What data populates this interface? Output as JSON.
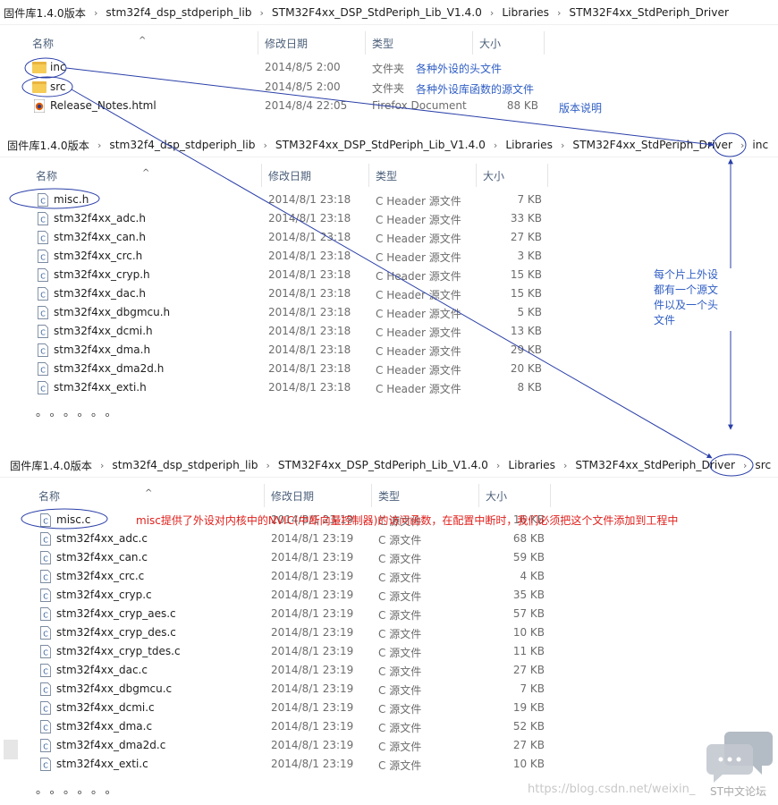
{
  "panel1": {
    "breadcrumb": [
      "固件库1.4.0版本",
      "stm32f4_dsp_stdperiph_lib",
      "STM32F4xx_DSP_StdPeriph_Lib_V1.4.0",
      "Libraries",
      "STM32F4xx_StdPeriph_Driver"
    ],
    "columns": {
      "name": "名称",
      "date": "修改日期",
      "type": "类型",
      "size": "大小"
    },
    "rows": [
      {
        "name": "inc",
        "date": "2014/8/5 2:00",
        "type": "文件夹",
        "size": "",
        "note": "各种外设的头文件"
      },
      {
        "name": "src",
        "date": "2014/8/5 2:00",
        "type": "文件夹",
        "size": "",
        "note": "各种外设库函数的源文件"
      },
      {
        "name": "Release_Notes.html",
        "date": "2014/8/4 22:05",
        "type": "Firefox Document",
        "size": "88 KB",
        "note": "版本说明"
      }
    ]
  },
  "panel2": {
    "breadcrumb": [
      "固件库1.4.0版本",
      "stm32f4_dsp_stdperiph_lib",
      "STM32F4xx_DSP_StdPeriph_Lib_V1.4.0",
      "Libraries",
      "STM32F4xx_StdPeriph_Driver",
      "inc"
    ],
    "columns": {
      "name": "名称",
      "date": "修改日期",
      "type": "类型",
      "size": "大小"
    },
    "rows": [
      {
        "name": "misc.h",
        "date": "2014/8/1 23:18",
        "type": "C Header 源文件",
        "size": "7 KB"
      },
      {
        "name": "stm32f4xx_adc.h",
        "date": "2014/8/1 23:18",
        "type": "C Header 源文件",
        "size": "33 KB"
      },
      {
        "name": "stm32f4xx_can.h",
        "date": "2014/8/1 23:18",
        "type": "C Header 源文件",
        "size": "27 KB"
      },
      {
        "name": "stm32f4xx_crc.h",
        "date": "2014/8/1 23:18",
        "type": "C Header 源文件",
        "size": "3 KB"
      },
      {
        "name": "stm32f4xx_cryp.h",
        "date": "2014/8/1 23:18",
        "type": "C Header 源文件",
        "size": "15 KB"
      },
      {
        "name": "stm32f4xx_dac.h",
        "date": "2014/8/1 23:18",
        "type": "C Header 源文件",
        "size": "15 KB"
      },
      {
        "name": "stm32f4xx_dbgmcu.h",
        "date": "2014/8/1 23:18",
        "type": "C Header 源文件",
        "size": "5 KB"
      },
      {
        "name": "stm32f4xx_dcmi.h",
        "date": "2014/8/1 23:18",
        "type": "C Header 源文件",
        "size": "13 KB"
      },
      {
        "name": "stm32f4xx_dma.h",
        "date": "2014/8/1 23:18",
        "type": "C Header 源文件",
        "size": "29 KB"
      },
      {
        "name": "stm32f4xx_dma2d.h",
        "date": "2014/8/1 23:18",
        "type": "C Header 源文件",
        "size": "20 KB"
      },
      {
        "name": "stm32f4xx_exti.h",
        "date": "2014/8/1 23:18",
        "type": "C Header 源文件",
        "size": "8 KB"
      }
    ],
    "ellipsis": "。。。。。。",
    "side_note": [
      "每个片上外设",
      "都有一个源文",
      "件以及一个头",
      "文件"
    ]
  },
  "panel3": {
    "breadcrumb": [
      "固件库1.4.0版本",
      "stm32f4_dsp_stdperiph_lib",
      "STM32F4xx_DSP_StdPeriph_Lib_V1.4.0",
      "Libraries",
      "STM32F4xx_StdPeriph_Driver",
      "src"
    ],
    "columns": {
      "name": "名称",
      "date": "修改日期",
      "type": "类型",
      "size": "大小"
    },
    "rows": [
      {
        "name": "misc.c",
        "date": "2014/8/1 23:19",
        "type": "C 源文件",
        "size": "16 KB"
      },
      {
        "name": "stm32f4xx_adc.c",
        "date": "2014/8/1 23:19",
        "type": "C 源文件",
        "size": "68 KB"
      },
      {
        "name": "stm32f4xx_can.c",
        "date": "2014/8/1 23:19",
        "type": "C 源文件",
        "size": "59 KB"
      },
      {
        "name": "stm32f4xx_crc.c",
        "date": "2014/8/1 23:19",
        "type": "C 源文件",
        "size": "4 KB"
      },
      {
        "name": "stm32f4xx_cryp.c",
        "date": "2014/8/1 23:19",
        "type": "C 源文件",
        "size": "35 KB"
      },
      {
        "name": "stm32f4xx_cryp_aes.c",
        "date": "2014/8/1 23:19",
        "type": "C 源文件",
        "size": "57 KB"
      },
      {
        "name": "stm32f4xx_cryp_des.c",
        "date": "2014/8/1 23:19",
        "type": "C 源文件",
        "size": "10 KB"
      },
      {
        "name": "stm32f4xx_cryp_tdes.c",
        "date": "2014/8/1 23:19",
        "type": "C 源文件",
        "size": "11 KB"
      },
      {
        "name": "stm32f4xx_dac.c",
        "date": "2014/8/1 23:19",
        "type": "C 源文件",
        "size": "27 KB"
      },
      {
        "name": "stm32f4xx_dbgmcu.c",
        "date": "2014/8/1 23:19",
        "type": "C 源文件",
        "size": "7 KB"
      },
      {
        "name": "stm32f4xx_dcmi.c",
        "date": "2014/8/1 23:19",
        "type": "C 源文件",
        "size": "19 KB"
      },
      {
        "name": "stm32f4xx_dma.c",
        "date": "2014/8/1 23:19",
        "type": "C 源文件",
        "size": "52 KB"
      },
      {
        "name": "stm32f4xx_dma2d.c",
        "date": "2014/8/1 23:19",
        "type": "C 源文件",
        "size": "27 KB"
      },
      {
        "name": "stm32f4xx_exti.c",
        "date": "2014/8/1 23:19",
        "type": "C 源文件",
        "size": "10 KB"
      }
    ],
    "misc_note": "misc提供了外设对内核中的NVIC(中断向量控制器)的访问函数，在配置中断时，我们必须把这个文件添加到工程中",
    "ellipsis": "。。。。。。"
  },
  "watermark": {
    "url": "https://blog.csdn.net/weixin_",
    "forum": "ST中文论坛"
  },
  "colors": {
    "annotation_blue": "#2f5ec4",
    "annotation_red": "#e0201c",
    "circle": "#2a3fa8",
    "folder": "#f6cc57"
  }
}
